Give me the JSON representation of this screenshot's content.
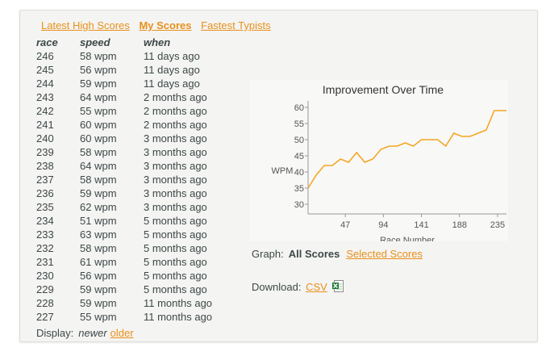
{
  "tabs": [
    {
      "label": "Latest High Scores",
      "active": false
    },
    {
      "label": "My Scores",
      "active": true
    },
    {
      "label": "Fastest Typists",
      "active": false
    }
  ],
  "table": {
    "headers": {
      "race": "race",
      "speed": "speed",
      "when": "when"
    },
    "rows": [
      {
        "race": "246",
        "speed": "58 wpm",
        "when": "11 days ago"
      },
      {
        "race": "245",
        "speed": "56 wpm",
        "when": "11 days ago"
      },
      {
        "race": "244",
        "speed": "59 wpm",
        "when": "11 days ago"
      },
      {
        "race": "243",
        "speed": "64 wpm",
        "when": "2 months ago"
      },
      {
        "race": "242",
        "speed": "55 wpm",
        "when": "2 months ago"
      },
      {
        "race": "241",
        "speed": "60 wpm",
        "when": "2 months ago"
      },
      {
        "race": "240",
        "speed": "60 wpm",
        "when": "3 months ago"
      },
      {
        "race": "239",
        "speed": "58 wpm",
        "when": "3 months ago"
      },
      {
        "race": "238",
        "speed": "64 wpm",
        "when": "3 months ago"
      },
      {
        "race": "237",
        "speed": "58 wpm",
        "when": "3 months ago"
      },
      {
        "race": "236",
        "speed": "59 wpm",
        "when": "3 months ago"
      },
      {
        "race": "235",
        "speed": "62 wpm",
        "when": "3 months ago"
      },
      {
        "race": "234",
        "speed": "51 wpm",
        "when": "5 months ago"
      },
      {
        "race": "233",
        "speed": "63 wpm",
        "when": "5 months ago"
      },
      {
        "race": "232",
        "speed": "58 wpm",
        "when": "5 months ago"
      },
      {
        "race": "231",
        "speed": "61 wpm",
        "when": "5 months ago"
      },
      {
        "race": "230",
        "speed": "56 wpm",
        "when": "5 months ago"
      },
      {
        "race": "229",
        "speed": "59 wpm",
        "when": "5 months ago"
      },
      {
        "race": "228",
        "speed": "59 wpm",
        "when": "11 months ago"
      },
      {
        "race": "227",
        "speed": "55 wpm",
        "when": "11 months ago"
      }
    ]
  },
  "display": {
    "label": "Display:",
    "current": "newer",
    "link": "older"
  },
  "graph": {
    "label": "Graph:",
    "current": "All Scores",
    "link": "Selected Scores"
  },
  "download": {
    "label": "Download:",
    "link": "CSV",
    "icon": "excel-file-icon"
  },
  "colors": {
    "link": "#e8901b",
    "line": "#f5a623",
    "text": "#3d4848"
  },
  "chart_data": {
    "type": "line",
    "title": "Improvement Over Time",
    "xlabel": "Race Number",
    "ylabel": "WPM",
    "xlim": [
      1,
      246
    ],
    "ylim": [
      27,
      62
    ],
    "x_ticks": [
      47,
      94,
      141,
      188,
      235
    ],
    "y_ticks": [
      30,
      35,
      40,
      45,
      50,
      55,
      60
    ],
    "grid": false,
    "series": [
      {
        "x": [
          1,
          11,
          21,
          31,
          41,
          51,
          61,
          71,
          81,
          91,
          101,
          111,
          121,
          131,
          141,
          151,
          161,
          171,
          181,
          191,
          201,
          211,
          221,
          231,
          241,
          246
        ],
        "y": [
          35,
          39,
          42,
          42,
          44,
          43,
          46,
          43,
          44,
          47,
          48,
          48,
          49,
          48,
          50,
          50,
          50,
          48,
          52,
          51,
          51,
          52,
          53,
          59,
          59,
          59
        ]
      }
    ]
  }
}
